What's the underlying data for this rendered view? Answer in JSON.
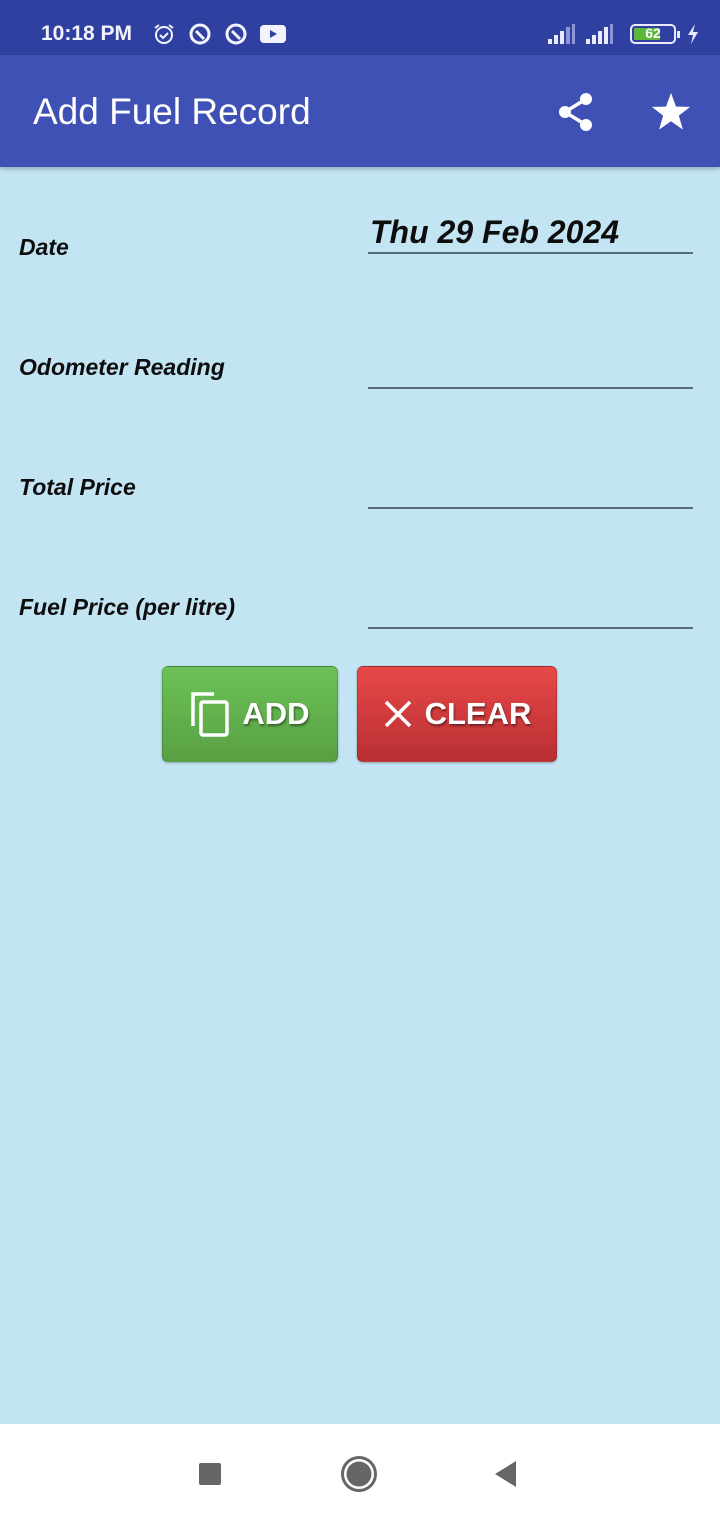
{
  "status_bar": {
    "time": "10:18 PM",
    "left_icons": [
      "alarm-icon",
      "app-notification-icon",
      "app-notification-icon",
      "youtube-icon"
    ],
    "right_icons": [
      "signal-icon",
      "signal-icon",
      "battery-icon",
      "charging-icon"
    ],
    "battery_level": "62"
  },
  "app_bar": {
    "title": "Add Fuel Record",
    "actions": [
      "share-icon",
      "star-icon"
    ]
  },
  "form": {
    "fields": [
      {
        "label": "Date",
        "value": "Thu 29 Feb 2024",
        "placeholder": ""
      },
      {
        "label": "Odometer Reading",
        "value": "",
        "placeholder": ""
      },
      {
        "label": "Total Price",
        "value": "",
        "placeholder": ""
      },
      {
        "label": "Fuel Price (per litre)",
        "value": "",
        "placeholder": ""
      }
    ]
  },
  "buttons": {
    "add_label": "ADD",
    "clear_label": "CLEAR"
  },
  "colors": {
    "status_bar": "#3040a0",
    "app_bar": "#3f51b5",
    "background": "#c2e4f3",
    "add_button": "#5faf4a",
    "clear_button": "#d63c3f"
  },
  "nav_bar": {
    "buttons": [
      "recents-icon",
      "home-icon",
      "back-icon"
    ]
  }
}
